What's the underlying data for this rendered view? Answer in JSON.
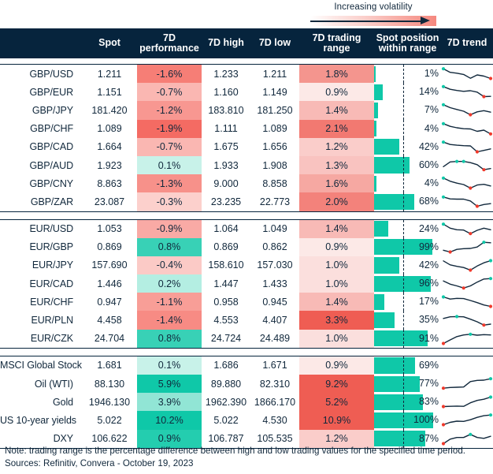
{
  "legend": {
    "label": "Increasing volatility",
    "gradient_from": "#ffffff",
    "gradient_to": "#f5887f"
  },
  "columns": [
    {
      "key": "label",
      "title": ""
    },
    {
      "key": "spot",
      "title": "Spot"
    },
    {
      "key": "perf",
      "title": "7D performance"
    },
    {
      "key": "high",
      "title": "7D high"
    },
    {
      "key": "low",
      "title": "7D low"
    },
    {
      "key": "range",
      "title": "7D trading range"
    },
    {
      "key": "position",
      "title": "Spot position within range"
    },
    {
      "key": "trend",
      "title": "7D trend"
    }
  ],
  "colors": {
    "header_bg": "#06243d",
    "text": "#11283c",
    "positive": "#0fc8a8",
    "negative": "#f5887f",
    "bar": "#0fc8a8",
    "spark_line": "#11283c",
    "spark_high_dot": "#0fc8a8",
    "spark_low_dot": "#f0392b"
  },
  "sections": [
    {
      "name": "gbp-pairs",
      "rows": [
        {
          "label": "GBP/USD",
          "spot": "1.211",
          "perf": "-1.6%",
          "perf_val": -1.6,
          "high": "1.233",
          "low": "1.211",
          "range": "1.8%",
          "range_val": 1.8,
          "position": "1%",
          "position_val": 1,
          "trend": [
            0.92,
            0.62,
            0.55,
            0.44,
            0.12,
            0.4,
            0.3,
            0.1
          ]
        },
        {
          "label": "GBP/EUR",
          "spot": "1.151",
          "perf": "-0.7%",
          "perf_val": -0.7,
          "high": "1.160",
          "low": "1.149",
          "range": "0.9%",
          "range_val": 0.9,
          "position": "14%",
          "position_val": 14,
          "trend": [
            0.95,
            0.72,
            0.62,
            0.55,
            0.6,
            0.48,
            0.1,
            0.12
          ]
        },
        {
          "label": "GBP/JPY",
          "spot": "181.420",
          "perf": "-1.2%",
          "perf_val": -1.2,
          "high": "183.810",
          "low": "181.250",
          "range": "1.4%",
          "range_val": 1.4,
          "position": "7%",
          "position_val": 7,
          "trend": [
            0.95,
            0.7,
            0.55,
            0.4,
            0.1,
            0.35,
            0.45,
            0.32
          ]
        },
        {
          "label": "GBP/CHF",
          "spot": "1.089",
          "perf": "-1.9%",
          "perf_val": -1.9,
          "high": "1.111",
          "low": "1.089",
          "range": "2.1%",
          "range_val": 2.1,
          "position": "4%",
          "position_val": 4,
          "trend": [
            0.95,
            0.72,
            0.6,
            0.52,
            0.5,
            0.3,
            0.4,
            0.08
          ]
        },
        {
          "label": "GBP/CAD",
          "spot": "1.664",
          "perf": "-0.7%",
          "perf_val": -0.7,
          "high": "1.675",
          "low": "1.656",
          "range": "1.2%",
          "range_val": 1.2,
          "position": "42%",
          "position_val": 42,
          "trend": [
            0.92,
            0.72,
            0.66,
            0.62,
            0.6,
            0.1,
            0.22,
            0.35
          ]
        },
        {
          "label": "GBP/AUD",
          "spot": "1.923",
          "perf": "0.1%",
          "perf_val": 0.1,
          "high": "1.933",
          "low": "1.908",
          "range": "1.3%",
          "range_val": 1.3,
          "position": "60%",
          "position_val": 60,
          "trend": [
            0.38,
            0.78,
            0.82,
            0.82,
            0.72,
            0.55,
            0.12,
            0.22
          ]
        },
        {
          "label": "GBP/CNY",
          "spot": "8.863",
          "perf": "-1.3%",
          "perf_val": -1.3,
          "high": "9.000",
          "low": "8.858",
          "range": "1.6%",
          "range_val": 1.6,
          "position": "4%",
          "position_val": 4,
          "trend": [
            0.95,
            0.68,
            0.52,
            0.4,
            0.1,
            0.36,
            0.42,
            0.28
          ]
        },
        {
          "label": "GBP/ZAR",
          "spot": "23.087",
          "perf": "-0.3%",
          "perf_val": -0.3,
          "high": "23.235",
          "low": "22.773",
          "range": "2.0%",
          "range_val": 2.0,
          "position": "68%",
          "position_val": 68,
          "trend": [
            0.88,
            0.72,
            0.7,
            0.7,
            0.55,
            0.1,
            0.25,
            0.32
          ]
        }
      ]
    },
    {
      "name": "eur-pairs",
      "rows": [
        {
          "label": "EUR/USD",
          "spot": "1.053",
          "perf": "-0.9%",
          "perf_val": -0.9,
          "high": "1.064",
          "low": "1.049",
          "range": "1.4%",
          "range_val": 1.4,
          "position": "24%",
          "position_val": 24,
          "trend": [
            0.92,
            0.58,
            0.45,
            0.42,
            0.12,
            0.4,
            0.58,
            0.45
          ]
        },
        {
          "label": "EUR/GBP",
          "spot": "0.869",
          "perf": "0.8%",
          "perf_val": 0.8,
          "high": "0.869",
          "low": "0.862",
          "range": "0.9%",
          "range_val": 0.9,
          "position": "99%",
          "position_val": 99,
          "trend": [
            0.25,
            0.1,
            0.32,
            0.38,
            0.4,
            0.52,
            0.92,
            0.88
          ]
        },
        {
          "label": "EUR/JPY",
          "spot": "157.690",
          "perf": "-0.4%",
          "perf_val": -0.4,
          "high": "158.610",
          "low": "157.030",
          "range": "1.0%",
          "range_val": 1.0,
          "position": "42%",
          "position_val": 42,
          "trend": [
            0.88,
            0.55,
            0.42,
            0.32,
            0.1,
            0.45,
            0.72,
            0.9
          ]
        },
        {
          "label": "EUR/CAD",
          "spot": "1.446",
          "perf": "0.2%",
          "perf_val": 0.2,
          "high": "1.447",
          "low": "1.433",
          "range": "1.0%",
          "range_val": 1.0,
          "position": "96%",
          "position_val": 96,
          "trend": [
            0.72,
            0.45,
            0.3,
            0.12,
            0.3,
            0.62,
            0.88,
            0.92
          ]
        },
        {
          "label": "EUR/CHF",
          "spot": "0.947",
          "perf": "-1.1%",
          "perf_val": -1.1,
          "high": "0.958",
          "low": "0.945",
          "range": "1.4%",
          "range_val": 1.4,
          "position": "17%",
          "position_val": 17,
          "trend": [
            0.9,
            0.72,
            0.78,
            0.76,
            0.6,
            0.42,
            0.22,
            0.1
          ]
        },
        {
          "label": "EUR/PLN",
          "spot": "4.458",
          "perf": "-1.4%",
          "perf_val": -1.4,
          "high": "4.553",
          "low": "4.407",
          "range": "3.3%",
          "range_val": 3.3,
          "position": "35%",
          "position_val": 35,
          "trend": [
            0.68,
            0.82,
            0.84,
            0.82,
            0.62,
            0.4,
            0.12,
            0.2
          ]
        },
        {
          "label": "EUR/CZK",
          "spot": "24.704",
          "perf": "0.8%",
          "perf_val": 0.8,
          "high": "24.724",
          "low": "24.489",
          "range": "1.0%",
          "range_val": 1.0,
          "position": "91%",
          "position_val": 91,
          "trend": [
            0.1,
            0.4,
            0.68,
            0.82,
            0.88,
            0.8,
            0.85,
            0.82
          ]
        }
      ]
    },
    {
      "name": "assets",
      "rows": [
        {
          "label": "MSCI Global Stock",
          "spot": "1.681",
          "perf": "0.1%",
          "perf_val": 0.1,
          "high": "1.686",
          "low": "1.671",
          "range": "0.9%",
          "range_val": 0.9,
          "position": "69%",
          "position_val": 69,
          "trend": []
        },
        {
          "label": "Oil (WTI)",
          "spot": "88.130",
          "perf": "5.9%",
          "perf_val": 5.9,
          "high": "89.880",
          "low": "82.310",
          "range": "9.2%",
          "range_val": 9.2,
          "position": "77%",
          "position_val": 77,
          "trend": [
            0.12,
            0.18,
            0.2,
            0.22,
            0.68,
            0.78,
            0.8,
            0.92
          ]
        },
        {
          "label": "Gold",
          "spot": "1946.130",
          "perf": "3.9%",
          "perf_val": 3.9,
          "high": "1962.390",
          "low": "1866.170",
          "range": "5.2%",
          "range_val": 5.2,
          "position": "83%",
          "position_val": 83,
          "trend": [
            0.1,
            0.12,
            0.14,
            0.12,
            0.42,
            0.62,
            0.72,
            0.9
          ]
        },
        {
          "label": "US 10-year yields",
          "spot": "5.022",
          "perf": "10.2%",
          "perf_val": 10.2,
          "high": "5.022",
          "low": "4.530",
          "range": "10.9%",
          "range_val": 10.9,
          "position": "100%",
          "position_val": 100,
          "trend": [
            0.1,
            0.3,
            0.4,
            0.38,
            0.52,
            0.72,
            0.86,
            0.92
          ]
        },
        {
          "label": "DXY",
          "spot": "106.622",
          "perf": "0.9%",
          "perf_val": 0.9,
          "high": "106.787",
          "low": "105.535",
          "range": "1.2%",
          "range_val": 1.2,
          "position": "87%",
          "position_val": 87,
          "trend": [
            0.1,
            0.48,
            0.62,
            0.62,
            0.88,
            0.62,
            0.55,
            0.72
          ]
        }
      ]
    }
  ],
  "footer": {
    "note": "Note: trading range is the percentage difference between high and low trading values for the specified time period.",
    "sources": "Sources: Refinitiv, Convera - October 19, 2023"
  }
}
